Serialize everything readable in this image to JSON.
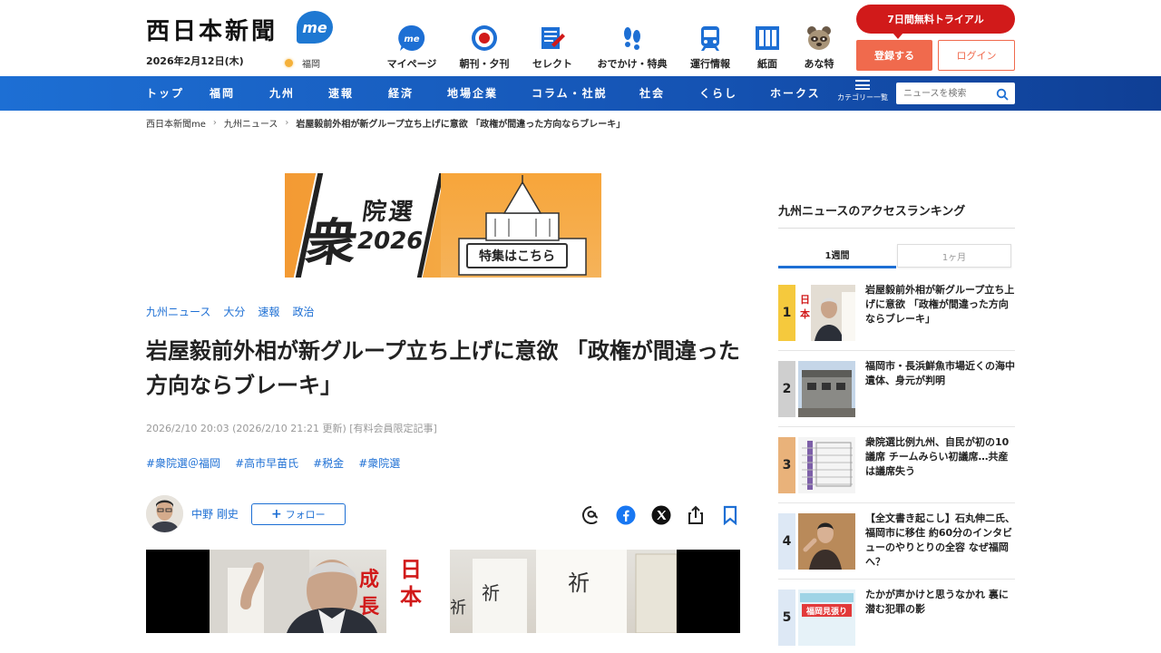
{
  "header": {
    "logo_text": "西日本新聞",
    "logo_badge": "me",
    "date": "2026年2月12日(木)",
    "weather_city": "福岡",
    "trial_label": "7日間無料トライアル",
    "register_label": "登録する",
    "login_label": "ログイン"
  },
  "top_nav": [
    {
      "label": "マイページ",
      "icon": "me-icon"
    },
    {
      "label": "朝刊・夕刊",
      "icon": "newspaper-target-icon"
    },
    {
      "label": "セレクト",
      "icon": "select-note-icon"
    },
    {
      "label": "おでかけ・特典",
      "icon": "footprints-icon"
    },
    {
      "label": "運行情報",
      "icon": "train-icon"
    },
    {
      "label": "紙面",
      "icon": "paper-icon"
    },
    {
      "label": "あな特",
      "icon": "raccoon-icon"
    }
  ],
  "main_nav": [
    "トップ",
    "福岡",
    "九州",
    "速報",
    "経済",
    "地場企業",
    "コラム・社説",
    "社会",
    "くらし",
    "ホークス"
  ],
  "category_label": "カテゴリー一覧",
  "search": {
    "placeholder": "ニュースを検索"
  },
  "breadcrumb": [
    "西日本新聞me",
    "九州ニュース",
    "岩屋毅前外相が新グループ立ち上げに意欲 「政権が間違った方向ならブレーキ」"
  ],
  "banner": {
    "shu": "衆",
    "insen": "院選",
    "year": "2026",
    "button": "特集はこちら"
  },
  "article": {
    "categories": [
      "九州ニュース",
      "大分",
      "速報",
      "政治"
    ],
    "title": "岩屋毅前外相が新グループ立ち上げに意欲 「政権が間違った方向ならブレーキ」",
    "meta": "2026/2/10 20:03 (2026/2/10 21:21 更新) [有料会員限定記事]",
    "hashtags": [
      "#衆院選＠福岡",
      "#高市早苗氏",
      "#税金",
      "#衆院選"
    ],
    "author": "中野 剛史",
    "follow_label": "フォロー"
  },
  "sidebar": {
    "title": "九州ニュースのアクセスランキング",
    "tabs": [
      "1週間",
      "1ヶ月"
    ],
    "ranking": [
      {
        "rank": "1",
        "text": "岩屋毅前外相が新グループ立ち上げに意欲 「政権が間違った方向ならブレーキ」",
        "color": "#f5c93d"
      },
      {
        "rank": "2",
        "text": "福岡市・長浜鮮魚市場近くの海中遺体、身元が判明",
        "color": "#cfcfcf"
      },
      {
        "rank": "3",
        "text": "衆院選比例九州、自民が初の10議席 チームみらい初議席…共産は議席失う",
        "color": "#e9b27a"
      },
      {
        "rank": "4",
        "text": "【全文書き起こし】石丸伸二氏、福岡市に移住 約60分のインタビューのやりとりの全容 なぜ福岡へ？",
        "color": "#dde8f5"
      },
      {
        "rank": "5",
        "text": "たかが声かけと思うなかれ 裏に潜む犯罪の影",
        "color": "#dde8f5"
      }
    ]
  },
  "colors": {
    "brand_blue": "#1d6fd4",
    "accent_red": "#d11a1a",
    "register_orange": "#f06a4d"
  }
}
